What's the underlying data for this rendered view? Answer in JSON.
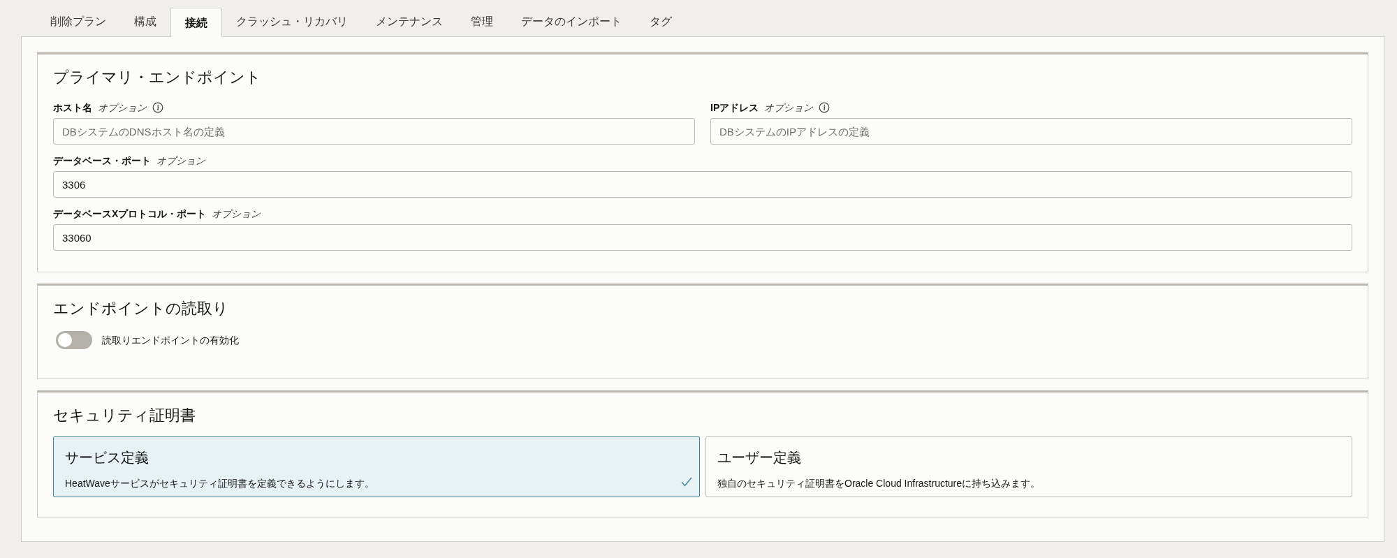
{
  "tabs": [
    {
      "label": "削除プラン",
      "selected": false
    },
    {
      "label": "構成",
      "selected": false
    },
    {
      "label": "接続",
      "selected": true
    },
    {
      "label": "クラッシュ・リカバリ",
      "selected": false
    },
    {
      "label": "メンテナンス",
      "selected": false
    },
    {
      "label": "管理",
      "selected": false
    },
    {
      "label": "データのインポート",
      "selected": false
    },
    {
      "label": "タグ",
      "selected": false
    }
  ],
  "primary_endpoint": {
    "title": "プライマリ・エンドポイント",
    "fields": [
      {
        "label": "ホスト名",
        "optional": "オプション",
        "info": true,
        "placeholder": "DBシステムのDNSホスト名の定義",
        "kind": "half"
      },
      {
        "label": "IPアドレス",
        "optional": "オプション",
        "info": true,
        "placeholder": "DBシステムのIPアドレスの定義",
        "kind": "half"
      },
      {
        "label": "データベース・ポート",
        "optional": "オプション",
        "info": false,
        "value": "3306",
        "kind": "full"
      },
      {
        "label": "データベースXプロトコル・ポート",
        "optional": "オプション",
        "info": false,
        "value": "33060",
        "kind": "full"
      }
    ]
  },
  "read_endpoint": {
    "title": "エンドポイントの読取り",
    "toggle": {
      "label": "読取りエンドポイントの有効化",
      "on": false
    }
  },
  "security_certificate": {
    "title": "セキュリティ証明書",
    "options": [
      {
        "title": "サービス定義",
        "description": "HeatWaveサービスがセキュリティ証明書を定義できるようにします。",
        "selected": true
      },
      {
        "title": "ユーザー定義",
        "description": "独自のセキュリティ証明書をOracle Cloud Infrastructureに持ち込みます。",
        "selected": false
      }
    ]
  }
}
